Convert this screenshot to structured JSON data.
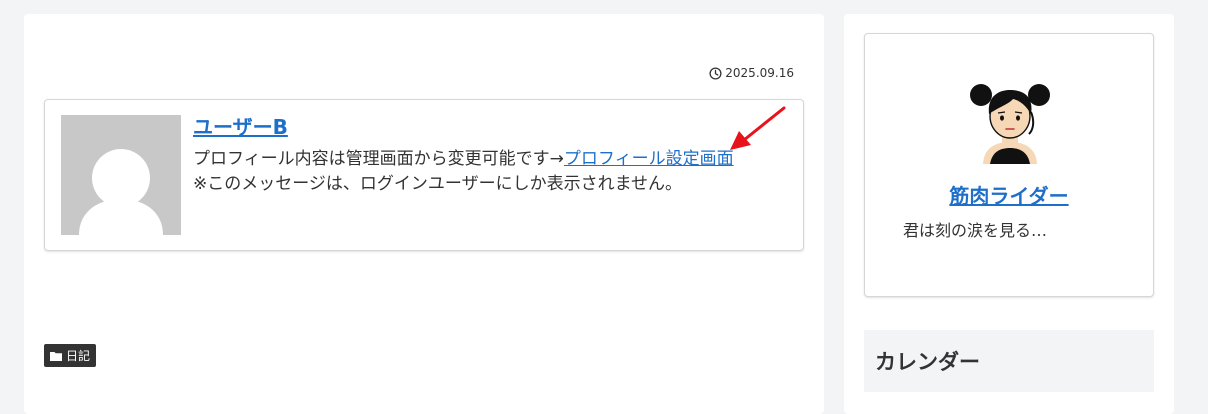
{
  "post": {
    "date": "2025.09.16",
    "category": "日記"
  },
  "author_box": {
    "name": "ユーザーB",
    "description_prefix": "プロフィール内容は管理画面から変更可能です→",
    "settings_link": "プロフィール設定画面",
    "notice": "※このメッセージは、ログインユーザーにしか表示されません。"
  },
  "sidebar": {
    "profile": {
      "name": "筋肉ライダー",
      "description": "君は刻の涙を見る…",
      "avatar_icon": "girl-avatar-icon"
    },
    "calendar_widget": {
      "title": "カレンダー"
    }
  },
  "colors": {
    "link": "#1e6fc9",
    "annotation_arrow": "#e8121b",
    "tag_bg": "#333333"
  }
}
